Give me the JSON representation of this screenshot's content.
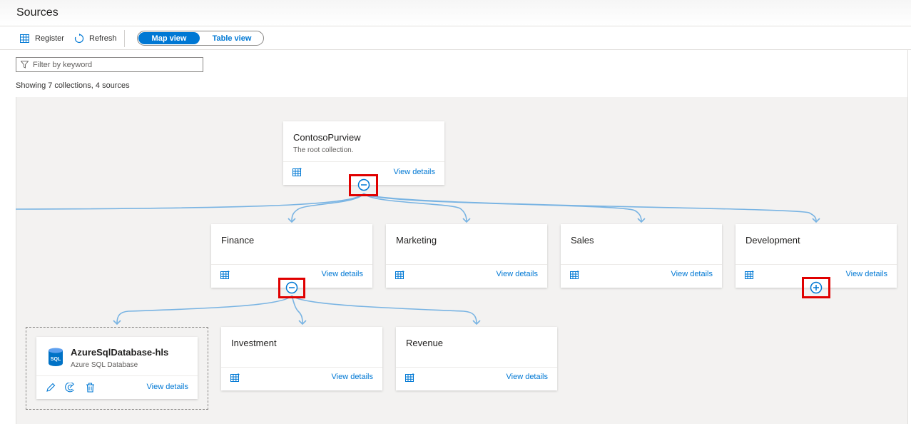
{
  "page": {
    "title": "Sources"
  },
  "toolbar": {
    "register_label": "Register",
    "refresh_label": "Refresh",
    "register_icon": "grid-register-icon",
    "refresh_icon": "refresh-icon"
  },
  "view_toggle": {
    "options": [
      "Map view",
      "Table view"
    ],
    "selected": "Map view"
  },
  "filter": {
    "placeholder": "Filter by keyword",
    "value": "",
    "icon": "filter-icon"
  },
  "summary": {
    "text": "Showing 7 collections, 4 sources"
  },
  "collections": {
    "root": {
      "name": "ContosoPurview",
      "description": "The root collection.",
      "link": "View details",
      "expanded": true
    },
    "finance": {
      "name": "Finance",
      "link": "View details",
      "expanded": true
    },
    "marketing": {
      "name": "Marketing",
      "link": "View details"
    },
    "sales": {
      "name": "Sales",
      "link": "View details"
    },
    "development": {
      "name": "Development",
      "link": "View details",
      "expanded": false
    },
    "investment": {
      "name": "Investment",
      "link": "View details"
    },
    "revenue": {
      "name": "Revenue",
      "link": "View details"
    }
  },
  "source": {
    "name": "AzureSqlDatabase-hls",
    "type": "Azure SQL Database",
    "badge": "SQL",
    "link": "View details",
    "actions": [
      "edit-icon",
      "scan-icon",
      "delete-icon"
    ]
  },
  "colors": {
    "accent": "#0078d4",
    "connector": "#79b4e3",
    "highlight": "#e00000",
    "canvas": "#f3f2f1"
  }
}
